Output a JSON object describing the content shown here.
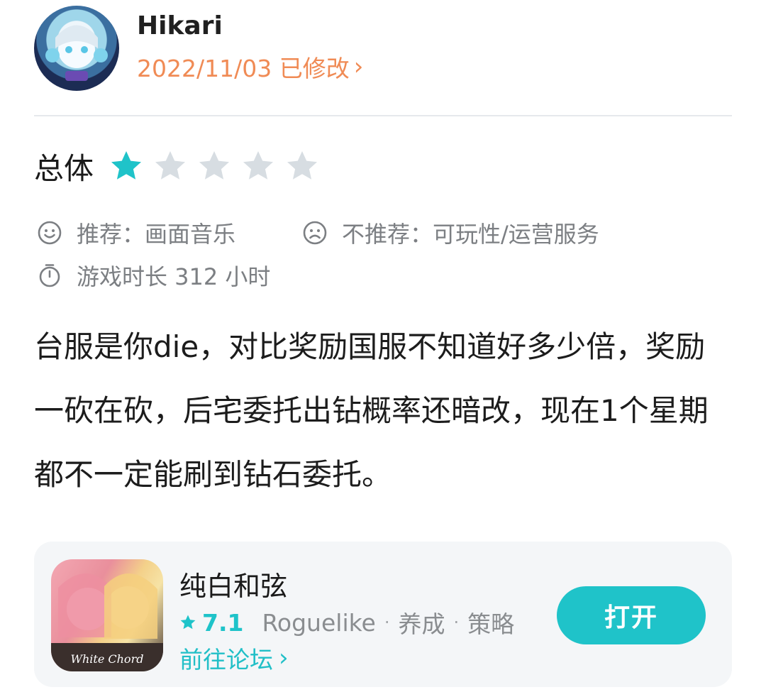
{
  "review": {
    "author": "Hikari",
    "date_line": "2022/11/03 已修改",
    "rating_label": "总体",
    "rating": {
      "value": 1,
      "max": 5
    },
    "recommend": "推荐：画面音乐",
    "not_recommend": "不推荐：可玩性/运营服务",
    "playtime": "游戏时长 312 小时",
    "body": "台服是你die，对比奖励国服不知道好多少倍，奖励一砍在砍，后宅委托出钻概率还暗改，现在1个星期都不一定能刷到钻石委托。"
  },
  "game": {
    "name": "纯白和弦",
    "score": "7.1",
    "tags": [
      "Roguelike",
      "养成",
      "策略"
    ],
    "forum_link": "前往论坛",
    "open_button": "打开",
    "icon_caption": "White Chord"
  },
  "colors": {
    "accent": "#1fc3c9",
    "date_orange": "#f08b55",
    "star_empty": "#d7dde2"
  },
  "icons": {
    "avatar": "user-avatar",
    "star": "star-icon",
    "smile": "smile-icon",
    "frown": "frown-icon",
    "timer": "stopwatch-icon",
    "chevron": "chevron-right-icon"
  }
}
